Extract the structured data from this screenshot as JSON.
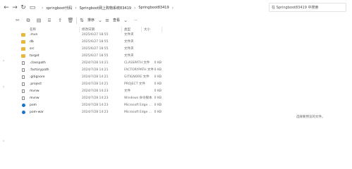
{
  "breadcrumb": [
    "springboot代码",
    "Springboot网上购物系统83419",
    "Springboot83419"
  ],
  "search": {
    "placeholder": "在 Springboot83419 中搜索"
  },
  "toolbar": {
    "sort_label": "排序",
    "view_label": "查看",
    "more_label": "···"
  },
  "columns": {
    "name": "名称",
    "date": "修改日期",
    "type": "类型",
    "size": "大小"
  },
  "files": [
    {
      "name": ".mvn",
      "date": "2025/6/27 18:55",
      "type": "文件夹",
      "size": "",
      "icon": "folder-icon"
    },
    {
      "name": "db",
      "date": "2025/6/27 18:55",
      "type": "文件夹",
      "size": "",
      "icon": "folder-icon"
    },
    {
      "name": "src",
      "date": "2025/6/27 18:55",
      "type": "文件夹",
      "size": "",
      "icon": "folder-icon"
    },
    {
      "name": "target",
      "date": "2025/6/27 18:55",
      "type": "文件夹",
      "size": "",
      "icon": "folder-icon"
    },
    {
      "name": ".classpath",
      "date": "2024/7/28 14:21",
      "type": "CLASSPATH 文件",
      "size": "0 KB",
      "icon": "file-icon"
    },
    {
      "name": ".factorypath",
      "date": "2024/7/28 14:21",
      "type": "FACTORYPATH 文件",
      "size": "0 KB",
      "icon": "file-icon"
    },
    {
      "name": ".gitignore",
      "date": "2024/7/28 14:21",
      "type": "GITIGNORE 文件",
      "size": "0 KB",
      "icon": "file-icon"
    },
    {
      "name": ".project",
      "date": "2024/7/28 14:21",
      "type": "PROJECT 文件",
      "size": "0 KB",
      "icon": "file-icon"
    },
    {
      "name": "mvnw",
      "date": "2024/7/28 14:23",
      "type": "文件",
      "size": "0 KB",
      "icon": "file-icon"
    },
    {
      "name": "mvnw",
      "date": "2024/7/28 14:23",
      "type": "Windows 命令脚本",
      "size": "0 KB",
      "icon": "file-icon"
    },
    {
      "name": "pom",
      "date": "2024/7/28 14:23",
      "type": "Microsoft Edge ...",
      "size": "0 KB",
      "icon": "edge-icon"
    },
    {
      "name": "pom-war",
      "date": "2024/7/28 14:23",
      "type": "Microsoft Edge ...",
      "size": "0 KB",
      "icon": "edge-icon"
    }
  ],
  "preview": {
    "message": "选择要预览的文件。"
  }
}
